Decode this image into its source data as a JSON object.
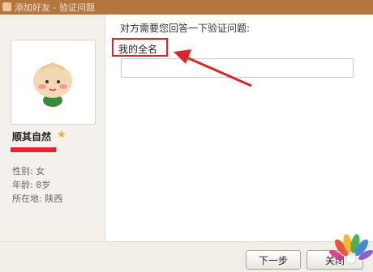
{
  "window": {
    "title": "添加好友 - 验证问题"
  },
  "profile": {
    "nickname": "顺其自然",
    "gender": "性别: 女",
    "age": "年龄: 8岁",
    "location": "所在地:  陕西"
  },
  "verification": {
    "prompt": "对方需要您回答一下验证问题:",
    "question": "我的全名",
    "answer_value": "",
    "answer_placeholder": ""
  },
  "buttons": {
    "next_label": "下一步",
    "close_label": "关闭"
  },
  "colors": {
    "annotation_red": "#d9262a",
    "title_bar": "#b5763d",
    "star": "#f5b21b"
  },
  "icons": {
    "star": "star-icon",
    "avatar": "avatar-image",
    "logo": "peacock-logo"
  }
}
